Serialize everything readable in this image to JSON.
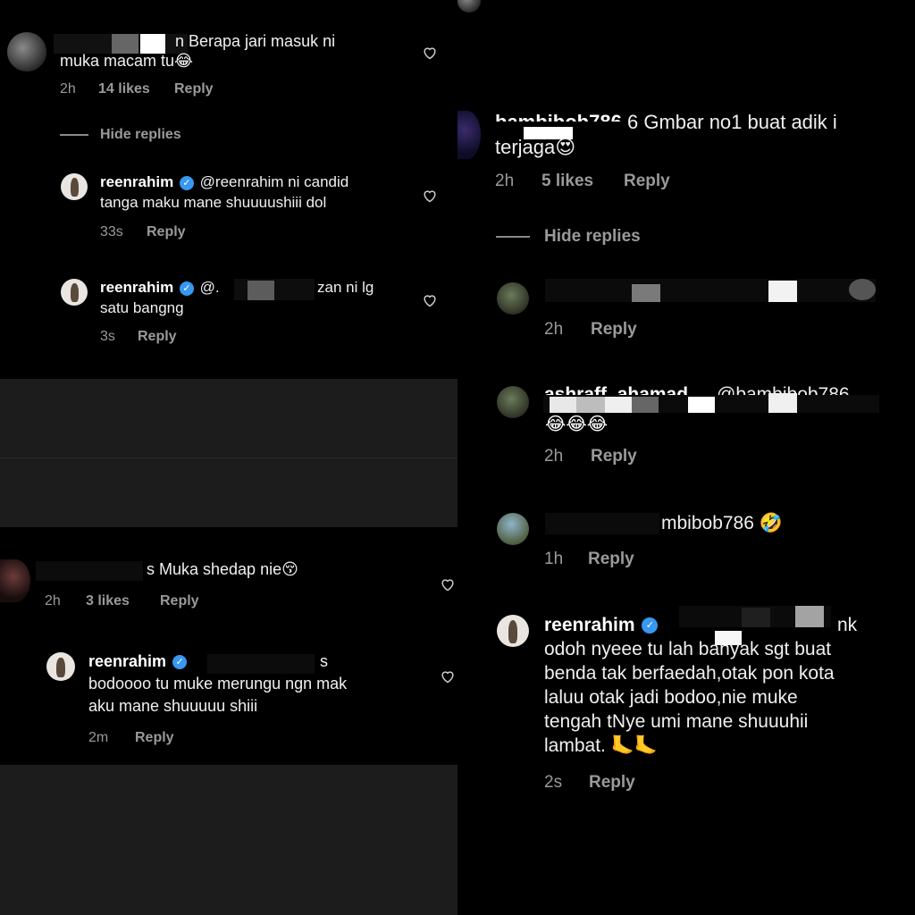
{
  "left_top": {
    "comment1": {
      "text_line1": "n Berapa jari masuk ni",
      "text_line2": "muka macam tu😂",
      "time": "2h",
      "likes": "14 likes",
      "reply": "Reply"
    },
    "hide_replies": "Hide replies",
    "reply1": {
      "username": "reenrahim",
      "text_line1": "@reenrahim ni candid",
      "text_line2": "tanga maku mane shuuuushiii dol",
      "time": "33s",
      "reply": "Reply"
    },
    "reply2": {
      "username": "reenrahim",
      "text_line1_a": "@.",
      "text_line1_b": "zan ni lg",
      "text_line2": "satu bangng",
      "time": "3s",
      "reply": "Reply"
    }
  },
  "left_bottom": {
    "comment1": {
      "text": "s Muka shedap nie😚",
      "time": "2h",
      "likes": "3 likes",
      "reply": "Reply"
    },
    "reply1": {
      "username": "reenrahim",
      "text_line1_end": "s",
      "text_line2": "bodoooo tu muke merungu ngn mak",
      "text_line3": "aku mane shuuuuu shiii",
      "time": "2m",
      "reply": "Reply"
    }
  },
  "right": {
    "comment1": {
      "username_partial": "bambibob786",
      "text_line1": "6 Gmbar no1 buat adik i",
      "text_line2": "terjaga😍",
      "time": "2h",
      "likes": "5 likes",
      "reply": "Reply"
    },
    "hide_replies": "Hide replies",
    "reply1": {
      "time": "2h",
      "reply": "Reply"
    },
    "reply2": {
      "username_partial": "ashraff_ahamad",
      "mention_partial": "@bambibob786",
      "emojis": "😂😂😂",
      "time": "2h",
      "reply": "Reply"
    },
    "reply3": {
      "text": "mbibob786 🤣",
      "time": "1h",
      "reply": "Reply"
    },
    "reply4": {
      "username": "reenrahim",
      "text_line1_end": "nk",
      "text_line2": "odoh nyeee tu lah banyak sgt buat",
      "text_line3": "benda tak berfaedah,otak pon kota",
      "text_line4": "laluu otak jadi bodoo,nie muke",
      "text_line5": "tengah tNye umi mane shuuuhii",
      "text_line6": "lambat. 🦶🦶",
      "time": "2s",
      "reply": "Reply"
    }
  },
  "colors": {
    "background": "#000000",
    "muted": "#9a9a9a",
    "verified": "#3897f0",
    "panel_gray": "#1c1c1c"
  },
  "icons": [
    "heart-icon",
    "verified-icon",
    "avatar"
  ]
}
